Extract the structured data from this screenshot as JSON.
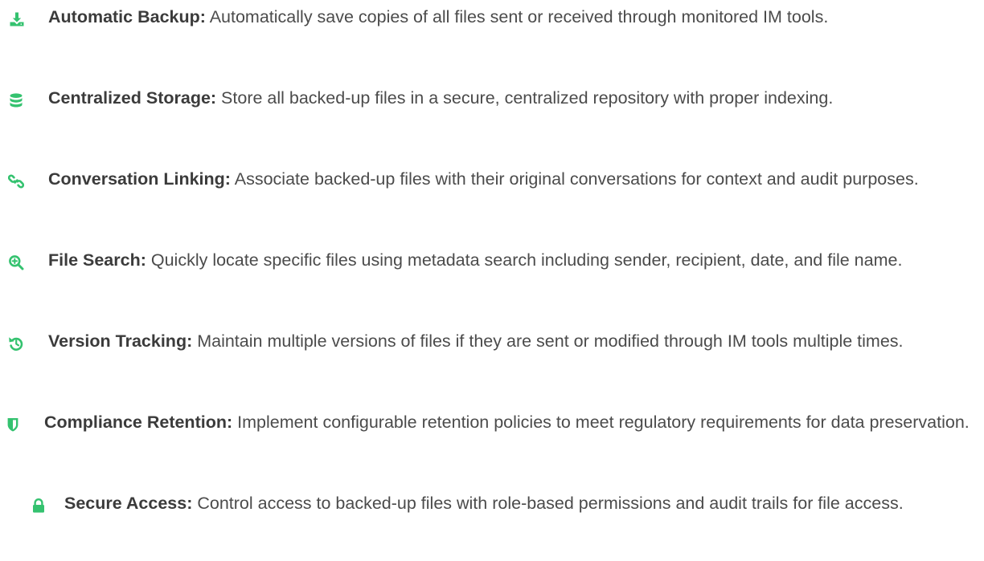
{
  "colors": {
    "accent_green": "#34c26f",
    "text": "#4b4b4b",
    "title_text": "#3b3b3b"
  },
  "features": [
    {
      "icon": "download-icon",
      "title": "Automatic Backup:",
      "description": " Automatically save copies of all files sent or received through monitored IM tools."
    },
    {
      "icon": "database-icon",
      "title": "Centralized Storage:",
      "description": " Store all backed-up files in a secure, centralized repository with proper indexing."
    },
    {
      "icon": "link-icon",
      "title": "Conversation Linking:",
      "description": " Associate backed-up files with their original conversations for context and audit purposes."
    },
    {
      "icon": "search-plus-icon",
      "title": "File Search:",
      "description": " Quickly locate specific files using metadata search including sender, recipient, date, and file name."
    },
    {
      "icon": "history-icon",
      "title": "Version Tracking:",
      "description": " Maintain multiple versions of files if they are sent or modified through IM tools multiple times."
    },
    {
      "icon": "shield-icon",
      "title": "Compliance Retention:",
      "description": " Implement configurable retention policies to meet regulatory requirements for data preservation."
    },
    {
      "icon": "lock-icon",
      "title": "Secure Access:",
      "description": " Control access to backed-up files with role-based permissions and audit trails for file access."
    }
  ]
}
